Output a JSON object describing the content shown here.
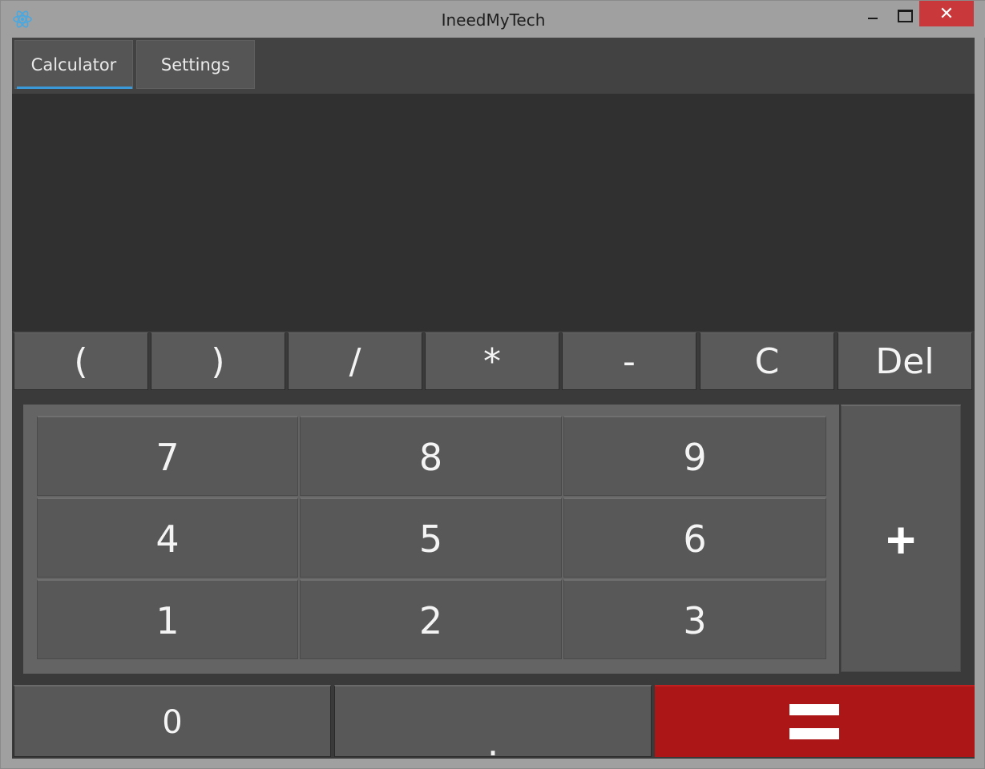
{
  "window": {
    "title": "IneedMyTech",
    "icon": "react-atom-icon",
    "controls": {
      "minimize": "minimize-icon",
      "maximize": "maximize-icon",
      "close": "✕"
    }
  },
  "tabs": [
    {
      "label": "Calculator",
      "active": true
    },
    {
      "label": "Settings",
      "active": false
    }
  ],
  "display": {
    "value": ""
  },
  "operators": [
    "(",
    ")",
    "/",
    "*",
    "-",
    "C",
    "Del"
  ],
  "keypad": {
    "rows": [
      [
        "7",
        "8",
        "9"
      ],
      [
        "4",
        "5",
        "6"
      ],
      [
        "1",
        "2",
        "3"
      ]
    ],
    "plus": "+"
  },
  "bottom": {
    "zero": "0",
    "dot": ".",
    "equals": "="
  },
  "colors": {
    "accent": "#3a9ad9",
    "equals_bg": "#ad1616",
    "close_bg": "#c9383a"
  }
}
